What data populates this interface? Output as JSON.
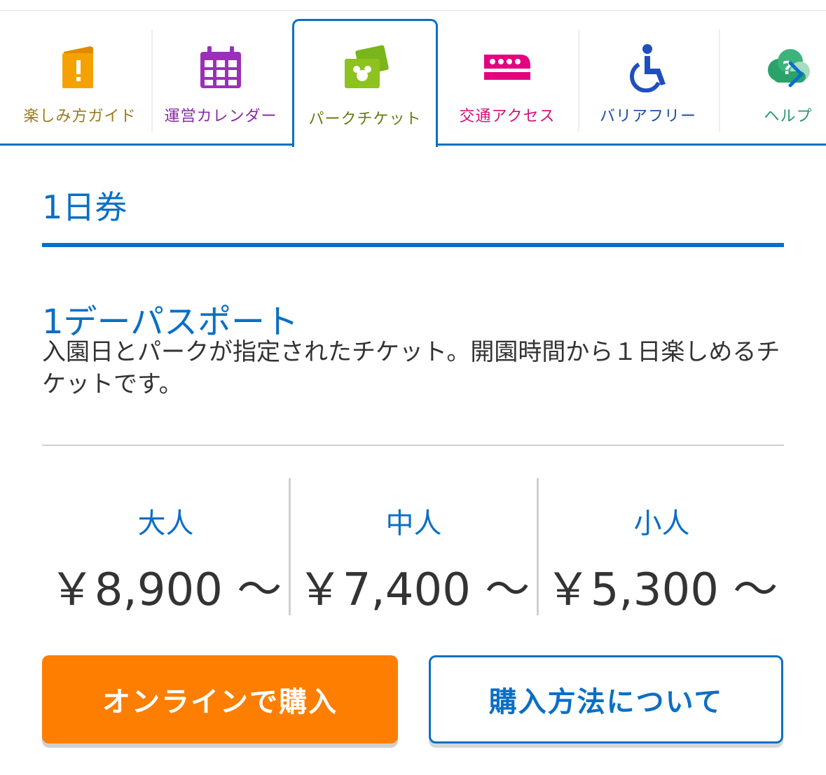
{
  "tabs": [
    {
      "label": "楽しみ方ガイド",
      "icon": "guide-book-icon",
      "color": "#9a7a1c",
      "icon_color": "#f5a200"
    },
    {
      "label": "運営カレンダー",
      "icon": "calendar-icon",
      "color": "#8a2aa6",
      "icon_color": "#9b2fb8"
    },
    {
      "label": "パークチケット",
      "icon": "park-ticket-icon",
      "color": "#6a7a10",
      "icon_color": "#8dc21f",
      "active": true
    },
    {
      "label": "交通アクセス",
      "icon": "monorail-icon",
      "color": "#d2127a",
      "icon_color": "#e4007f"
    },
    {
      "label": "バリアフリー",
      "icon": "wheelchair-icon",
      "color": "#1a4ea8",
      "icon_color": "#1f4fbf"
    },
    {
      "label": "ヘルプ",
      "icon": "help-cloud-icon",
      "color": "#2a9a6a",
      "icon_color": "#2aa36b"
    }
  ],
  "section": {
    "title": "1日券"
  },
  "ticket": {
    "name": "1デーパスポート",
    "description": "入園日とパークが指定されたチケット。開園時間から１日楽しめるチケットです。"
  },
  "prices": [
    {
      "kind": "大人",
      "amount": "￥8,900 ～"
    },
    {
      "kind": "中人",
      "amount": "￥7,400 ～"
    },
    {
      "kind": "小人",
      "amount": "￥5,300 ～"
    }
  ],
  "buttons": {
    "online": "オンラインで購入",
    "howto": "購入方法について"
  },
  "colors": {
    "accent": "#0b6fc4",
    "orange": "#fd7e00"
  }
}
